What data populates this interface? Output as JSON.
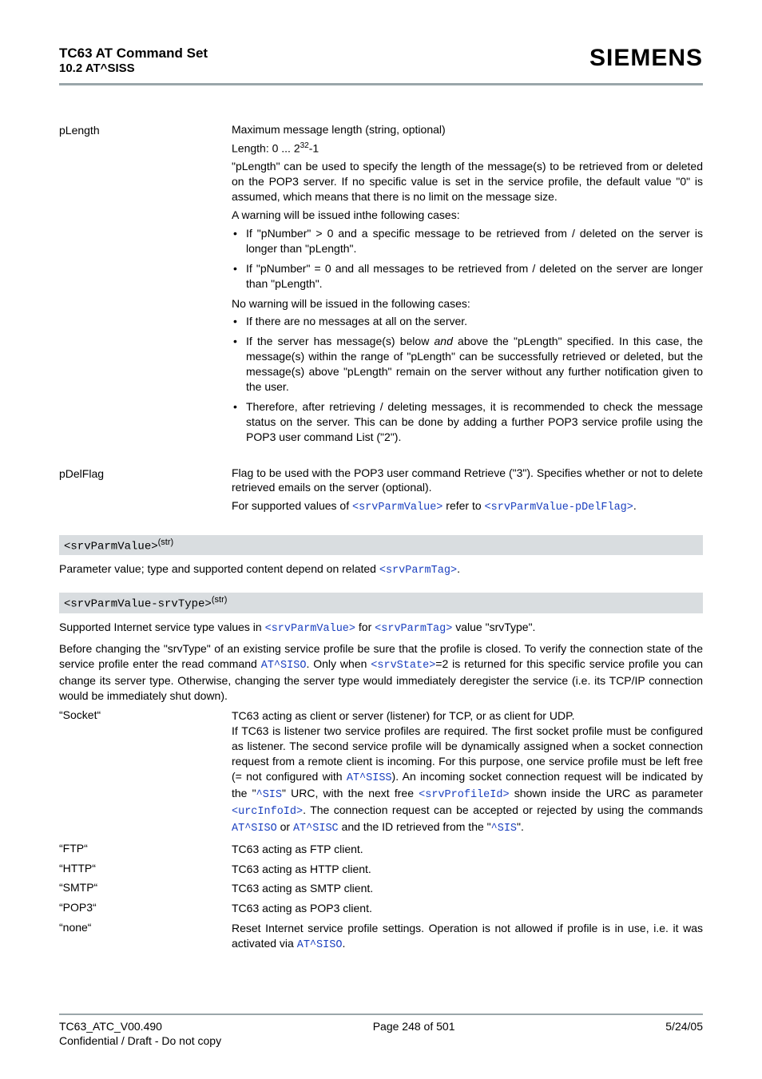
{
  "header": {
    "title1": "TC63 AT Command Set",
    "title2": "10.2 AT^SISS",
    "brand": "SIEMENS"
  },
  "params": {
    "pLength": {
      "label": "pLength",
      "line1": "Maximum message length (string, optional)",
      "line2a": "Length: 0 ... 2",
      "line2b": "-1",
      "desc": "\"pLength\" can be used to specify the length of the message(s) to be retrieved from or deleted on the POP3 server. If no specific value is set in the service profile, the default value \"0\" is assumed, which means that there is no limit on the message size.",
      "warnIntro": "A warning will be issued inthe following cases:",
      "warn1": "If \"pNumber\" > 0 and a specific message to be retrieved from / deleted on the server is longer than \"pLength\".",
      "warn2": "If \"pNumber\" = 0 and all messages to be retrieved from / deleted on the server are longer than \"pLength\".",
      "nowarnIntro": "No warning will be issued in the following cases:",
      "nw1": "If there are no messages at all on the server.",
      "nw2a": "If the server has message(s) below ",
      "nw2i": "and",
      "nw2b": " above the \"pLength\" specified. In this case, the message(s) within the range of \"pLength\" can be successfully retrieved or deleted, but the message(s) above \"pLength\" remain on the server without any further notification given to the user.",
      "nw3": "Therefore, after retrieving / deleting messages, it is recommended to check the message status on the server. This can be done by adding a further POP3 service profile using the POP3 user command List (\"2\")."
    },
    "pDelFlag": {
      "label": "pDelFlag",
      "desc": "Flag to be used with the POP3 user command Retrieve (\"3\"). Specifies whether or not to delete retrieved emails on the server (optional).",
      "sup_a": "For supported values of ",
      "sup_l1": "<srvParmValue>",
      "sup_b": " refer to ",
      "sup_l2": "<srvParmValue-pDelFlag>",
      "sup_c": "."
    }
  },
  "bars": {
    "srvParmValue": "<srvParmValue>",
    "srvParmValueSrvType": "<srvParmValue-srvType>",
    "strSuffix": "(str)"
  },
  "pval": {
    "a": "Parameter value; type and supported content depend on related ",
    "l": "<srvParmTag>",
    "b": "."
  },
  "srvtype": {
    "intro_a": "Supported Internet service type values in ",
    "intro_l1": "<srvParmValue>",
    "intro_b": " for ",
    "intro_l2": "<srvParmTag>",
    "intro_c": " value \"srvType\".",
    "p2a": "Before changing the \"srvType\" of an existing service profile be sure that the profile is closed. To verify the connection state of the service profile enter the read command ",
    "p2l1": "AT^SISO",
    "p2b": ". Only when ",
    "p2l2": "<srvState>",
    "p2c": "=2 is returned for this specific service profile you can change its server type. Otherwise, changing the server type would immediately deregister the service (i.e. its TCP/IP connection would be immediately shut down)."
  },
  "services": {
    "socket": {
      "key": "“Socket“",
      "a": "TC63 acting as client or server (listener) for TCP, or as client for UDP.",
      "b1": "If TC63 is listener two service profiles are required. The first socket profile must be configured as listener. The second service profile will be dynamically assigned when a socket connection request from a remote client is incoming. For this purpose, one service profile must be left free (= not configured with ",
      "l1": "AT^SISS",
      "b2": "). An incoming socket connection request will be indicated by the \"",
      "l2": "^SIS",
      "b3": "\" URC, with the next free ",
      "l3": "<srvProfileId>",
      "b4": " shown inside the URC as parameter ",
      "l4": "<urcInfoId>",
      "b5": ". The connection request can be accepted or rejected by using the commands ",
      "l5": "AT^SISO",
      "b6": " or ",
      "l6": "AT^SISC",
      "b7": " and the ID retrieved from the \"",
      "l7": "^SIS",
      "b8": "\"."
    },
    "ftp": {
      "key": "“FTP“",
      "val": "TC63 acting as FTP client."
    },
    "http": {
      "key": "“HTTP“",
      "val": "TC63 acting as HTTP client."
    },
    "smtp": {
      "key": "“SMTP“",
      "val": "TC63 acting as SMTP client."
    },
    "pop3": {
      "key": "“POP3“",
      "val": "TC63 acting as POP3 client."
    },
    "none": {
      "key": "“none“",
      "a": "Reset Internet service profile settings. Operation is not allowed if profile is in use, i.e. it was activated via ",
      "l": "AT^SISO",
      "b": "."
    }
  },
  "footer": {
    "left1": "TC63_ATC_V00.490",
    "center": "Page 248 of 501",
    "right": "5/24/05",
    "left2": "Confidential / Draft - Do not copy"
  }
}
